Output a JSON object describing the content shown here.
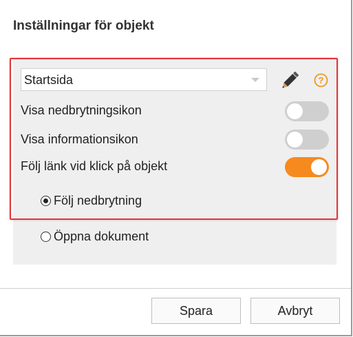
{
  "dialog": {
    "title": "Inställningar för objekt"
  },
  "object_select": {
    "value": "Startsida"
  },
  "icons": {
    "edit": "pencil-icon",
    "help": "help-icon"
  },
  "settings": [
    {
      "label": "Visa nedbrytningsikon",
      "enabled": false
    },
    {
      "label": "Visa informationsikon",
      "enabled": false
    },
    {
      "label": "Följ länk vid klick på objekt",
      "enabled": true
    }
  ],
  "link_action": {
    "options": [
      {
        "label": "Följ nedbrytning",
        "selected": true
      },
      {
        "label": "Öppna dokument",
        "selected": false
      }
    ]
  },
  "buttons": {
    "save": "Spara",
    "cancel": "Avbryt"
  },
  "colors": {
    "highlight_border": "#e0353b",
    "toggle_on": "#f68a1e",
    "toggle_off": "#cfcfcf",
    "help_icon": "#f0961e"
  }
}
